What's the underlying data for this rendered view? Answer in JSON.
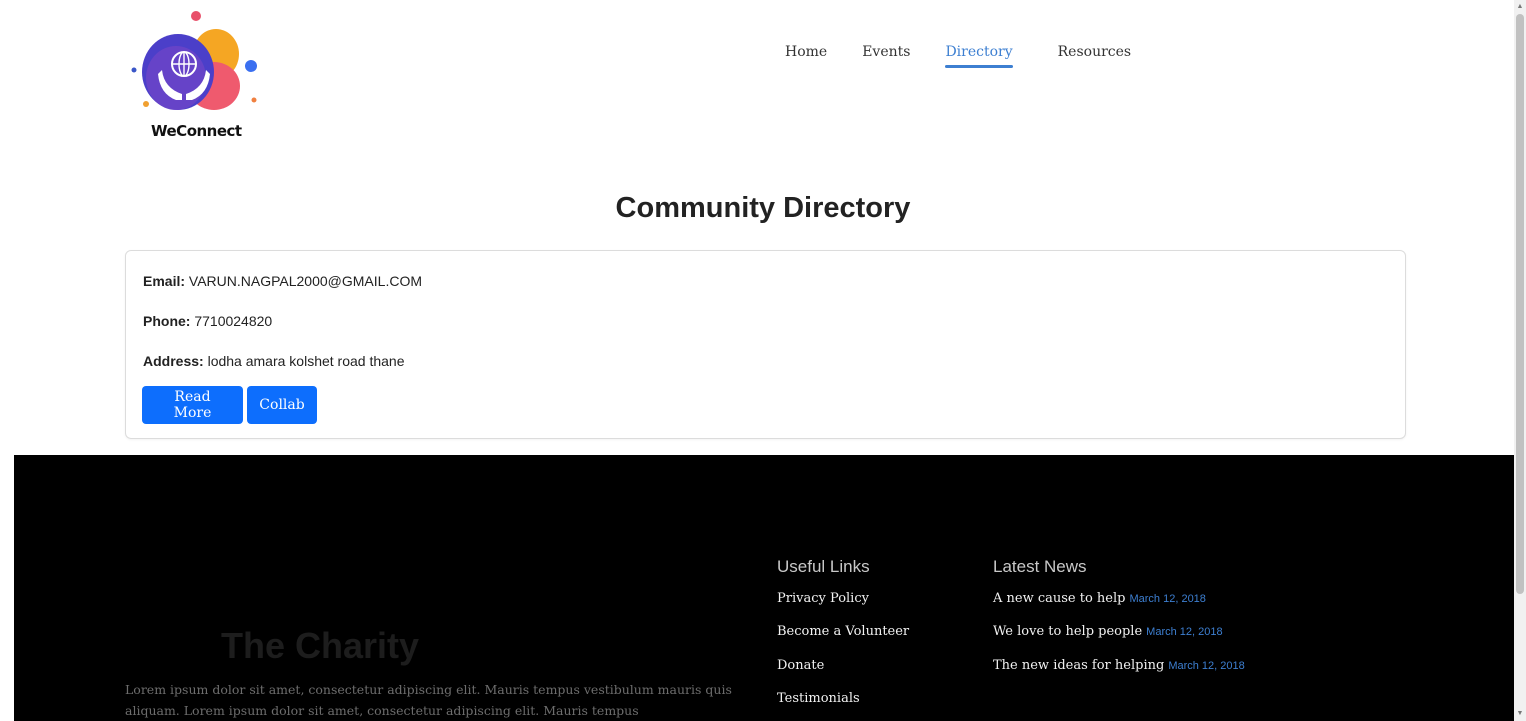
{
  "brand": {
    "name": "WeConnect"
  },
  "nav": {
    "items": [
      {
        "label": "Home"
      },
      {
        "label": "Events"
      },
      {
        "label": "Directory",
        "active": true
      },
      {
        "label": "Resources"
      }
    ],
    "accent_color": "#3d7fd1"
  },
  "page": {
    "title": "Community Directory"
  },
  "entry": {
    "email_label": "Email:",
    "email_value": "VARUN.NAGPAL2000@GMAIL.COM",
    "phone_label": "Phone:",
    "phone_value": "7710024820",
    "address_label": "Address:",
    "address_value": "lodha amara kolshet road thane",
    "read_more_label": "Read More",
    "collab_label": "Collab",
    "button_color": "#0d6efd"
  },
  "footer": {
    "charity_title": "The Charity",
    "charity_text": "Lorem ipsum dolor sit amet, consectetur adipiscing elit. Mauris tempus vestibulum mauris quis aliquam. Lorem ipsum dolor sit amet, consectetur adipiscing elit. Mauris tempus",
    "useful_links_heading": "Useful Links",
    "useful_links": [
      {
        "label": "Privacy Policy"
      },
      {
        "label": "Become a Volunteer"
      },
      {
        "label": "Donate"
      },
      {
        "label": "Testimonials"
      }
    ],
    "latest_news_heading": "Latest News",
    "latest_news": [
      {
        "title": "A new cause to help",
        "date": "March 12, 2018"
      },
      {
        "title": "We love to help people",
        "date": "March 12, 2018"
      },
      {
        "title": "The new ideas for helping",
        "date": "March 12, 2018"
      }
    ]
  }
}
